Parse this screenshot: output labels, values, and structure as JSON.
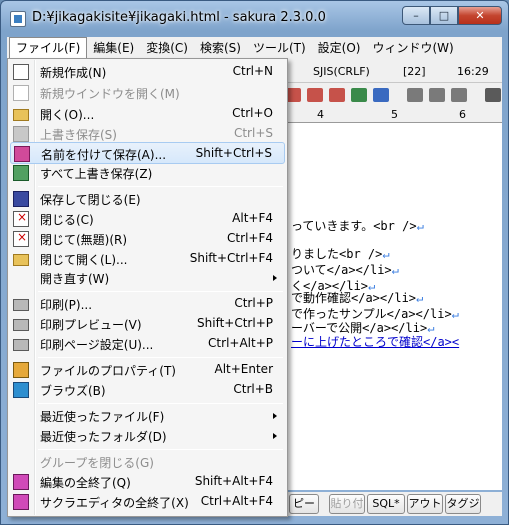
{
  "window": {
    "title": "D:¥jikagakisite¥jikagaki.html - sakura 2.3.0.0",
    "minimize_glyph": "–",
    "maximize_glyph": "□",
    "close_glyph": "✕"
  },
  "menubar": [
    {
      "label": "ファイル(F)",
      "active": true
    },
    {
      "label": "編集(E)"
    },
    {
      "label": "変換(C)"
    },
    {
      "label": "検索(S)"
    },
    {
      "label": "ツール(T)"
    },
    {
      "label": "設定(O)"
    },
    {
      "label": "ウィンドウ(W)"
    }
  ],
  "status": {
    "encoding": "SJIS(CRLF)",
    "position": "[22]",
    "time": "16:29"
  },
  "ruler": {
    "marks": [
      "4",
      "5",
      "6"
    ]
  },
  "editor_lines": [
    {
      "text": "っていきます。<br />",
      "ret": "↵"
    },
    {
      "text": "りました<br />",
      "ret": "↵"
    },
    {
      "text": "ついて</a></li>",
      "ret": "↵"
    },
    {
      "text": "く</a></li>",
      "ret": "↵"
    },
    {
      "text": "で動作確認</a></li>",
      "ret": "↵"
    },
    {
      "text": "で作ったサンプル</a></li>",
      "ret": "↵"
    },
    {
      "text": "ーバーで公開</a></li>",
      "ret": "↵"
    },
    {
      "text": "ーに上げたところで確認</a><",
      "ret": ""
    }
  ],
  "func_buttons": [
    {
      "label": "ピー",
      "disabled": false
    },
    {
      "label": "貼り付",
      "disabled": true
    },
    {
      "label": "SQL*",
      "disabled": false
    },
    {
      "label": "アウト",
      "disabled": false
    },
    {
      "label": "タグジ",
      "disabled": false
    }
  ],
  "file_menu": {
    "items": [
      {
        "label": "新規作成(N)",
        "shortcut": "Ctrl+N",
        "icon": "new-document-icon"
      },
      {
        "label": "新規ウインドウを開く(M)",
        "shortcut": "",
        "icon": "new-window-icon",
        "disabled": true
      },
      {
        "label": "開く(O)...",
        "shortcut": "Ctrl+O",
        "icon": "open-folder-icon"
      },
      {
        "label": "上書き保存(S)",
        "shortcut": "Ctrl+S",
        "icon": "save-disk-icon",
        "disabled": true
      },
      {
        "label": "名前を付けて保存(A)...",
        "shortcut": "Shift+Ctrl+S",
        "icon": "save-as-icon",
        "highlighted": true
      },
      {
        "label": "すべて上書き保存(Z)",
        "shortcut": "",
        "icon": "save-all-icon"
      },
      {
        "label": "保存して閉じる(E)",
        "shortcut": "",
        "icon": "save-close-icon"
      },
      {
        "label": "閉じる(C)",
        "shortcut": "Alt+F4",
        "icon": "close-document-icon"
      },
      {
        "label": "閉じて(無題)(R)",
        "shortcut": "Ctrl+F4",
        "icon": "close-untitled-icon"
      },
      {
        "label": "閉じて開く(L)...",
        "shortcut": "Shift+Ctrl+F4",
        "icon": "close-open-icon"
      },
      {
        "label": "開き直す(W)",
        "shortcut": "",
        "submenu": true
      },
      {
        "label": "印刷(P)...",
        "shortcut": "Ctrl+P",
        "icon": "print-icon"
      },
      {
        "label": "印刷プレビュー(V)",
        "shortcut": "Shift+Ctrl+P",
        "icon": "print-preview-icon"
      },
      {
        "label": "印刷ページ設定(U)...",
        "shortcut": "Ctrl+Alt+P",
        "icon": "page-setup-icon"
      },
      {
        "label": "ファイルのプロパティ(T)",
        "shortcut": "Alt+Enter",
        "icon": "properties-icon"
      },
      {
        "label": "ブラウズ(B)",
        "shortcut": "Ctrl+B",
        "icon": "browse-icon"
      },
      {
        "label": "最近使ったファイル(F)",
        "shortcut": "",
        "submenu": true
      },
      {
        "label": "最近使ったフォルダ(D)",
        "shortcut": "",
        "submenu": true
      },
      {
        "label": "グループを閉じる(G)",
        "shortcut": "",
        "disabled": true
      },
      {
        "label": "編集の全終了(Q)",
        "shortcut": "Shift+Alt+F4",
        "icon": "exit-edit-icon"
      },
      {
        "label": "サクラエディタの全終了(X)",
        "shortcut": "Ctrl+Alt+F4",
        "icon": "exit-all-icon"
      }
    ]
  }
}
